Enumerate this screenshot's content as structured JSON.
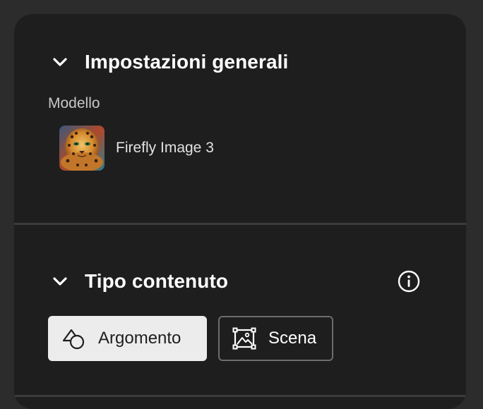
{
  "general_settings": {
    "title": "Impostazioni generali",
    "chevron_icon": "chevron-down-icon"
  },
  "model": {
    "label": "Modello",
    "name": "Firefly Image 3",
    "thumbnail": "leopard-thumbnail"
  },
  "content_type": {
    "title": "Tipo contenuto",
    "chevron_icon": "chevron-down-icon",
    "info_icon": "info-icon",
    "options": [
      {
        "label": "Argomento",
        "icon": "subject-shapes-icon",
        "selected": true
      },
      {
        "label": "Scena",
        "icon": "scene-image-icon",
        "selected": false
      }
    ]
  },
  "colors": {
    "background": "#2c2c2c",
    "panel": "#1e1e1e",
    "selected_button": "#ececec",
    "button_border": "#6c6c6c",
    "divider": "#3c3c3c"
  }
}
